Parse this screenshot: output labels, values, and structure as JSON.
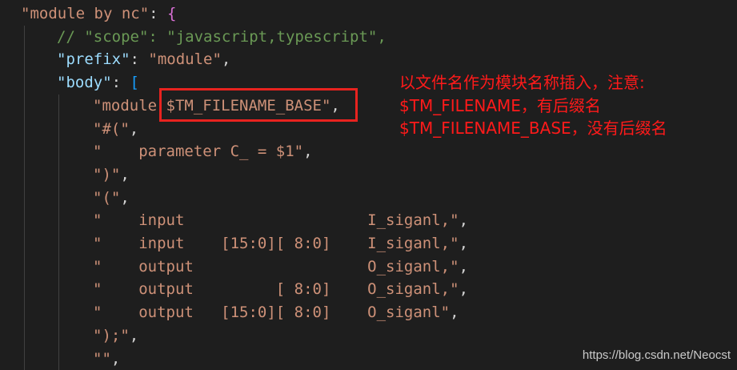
{
  "code_lines": [
    {
      "indent": 0,
      "tokens": [
        {
          "t": "\"module by nc\"",
          "c": "str"
        },
        {
          "t": ": ",
          "c": "punc"
        },
        {
          "t": "{",
          "c": "brace"
        }
      ]
    },
    {
      "indent": 1,
      "tokens": [
        {
          "t": "// \"scope\": \"javascript,typescript\",",
          "c": "comment"
        }
      ]
    },
    {
      "indent": 1,
      "tokens": [
        {
          "t": "\"prefix\"",
          "c": "key"
        },
        {
          "t": ": ",
          "c": "punc"
        },
        {
          "t": "\"module\"",
          "c": "str"
        },
        {
          "t": ",",
          "c": "punc"
        }
      ]
    },
    {
      "indent": 1,
      "tokens": [
        {
          "t": "\"body\"",
          "c": "key"
        },
        {
          "t": ": ",
          "c": "punc"
        },
        {
          "t": "[",
          "c": "bracket"
        }
      ]
    },
    {
      "indent": 2,
      "tokens": [
        {
          "t": "\"module $TM_FILENAME_BASE\"",
          "c": "str"
        },
        {
          "t": ",",
          "c": "punc"
        }
      ]
    },
    {
      "indent": 2,
      "tokens": [
        {
          "t": "\"#(\"",
          "c": "str"
        },
        {
          "t": ",",
          "c": "punc"
        }
      ]
    },
    {
      "indent": 2,
      "tokens": [
        {
          "t": "\"    parameter C_ = $1\"",
          "c": "str"
        },
        {
          "t": ",",
          "c": "punc"
        }
      ]
    },
    {
      "indent": 2,
      "tokens": [
        {
          "t": "\")\"",
          "c": "str"
        },
        {
          "t": ",",
          "c": "punc"
        }
      ]
    },
    {
      "indent": 2,
      "tokens": [
        {
          "t": "\"(\"",
          "c": "str"
        },
        {
          "t": ",",
          "c": "punc"
        }
      ]
    },
    {
      "indent": 2,
      "tokens": [
        {
          "t": "\"    input                    I_siganl,\"",
          "c": "str"
        },
        {
          "t": ",",
          "c": "punc"
        }
      ]
    },
    {
      "indent": 2,
      "tokens": [
        {
          "t": "\"    input    [15:0][ 8:0]    I_siganl,\"",
          "c": "str"
        },
        {
          "t": ",",
          "c": "punc"
        }
      ]
    },
    {
      "indent": 2,
      "tokens": [
        {
          "t": "\"    output                   O_siganl,\"",
          "c": "str"
        },
        {
          "t": ",",
          "c": "punc"
        }
      ]
    },
    {
      "indent": 2,
      "tokens": [
        {
          "t": "\"    output         [ 8:0]    O_siganl,\"",
          "c": "str"
        },
        {
          "t": ",",
          "c": "punc"
        }
      ]
    },
    {
      "indent": 2,
      "tokens": [
        {
          "t": "\"    output   [15:0][ 8:0]    O_siganl\"",
          "c": "str"
        },
        {
          "t": ",",
          "c": "punc"
        }
      ]
    },
    {
      "indent": 2,
      "tokens": [
        {
          "t": "\");\"",
          "c": "str"
        },
        {
          "t": ",",
          "c": "punc"
        }
      ]
    },
    {
      "indent": 2,
      "tokens": [
        {
          "t": "\"\"",
          "c": "str"
        },
        {
          "t": ",",
          "c": "punc"
        }
      ]
    }
  ],
  "annotation": {
    "lines": [
      "以文件名作为模块名称插入，注意:",
      "$TM_FILENAME，有后缀名",
      "$TM_FILENAME_BASE，没有后缀名"
    ]
  },
  "watermark": "https://blog.csdn.net/Neocst",
  "colors": {
    "background": "#1e1e1e",
    "string": "#ce9178",
    "key": "#9cdcfe",
    "comment": "#6a9955",
    "brace": "#da70d6",
    "bracket": "#179fff",
    "annotation": "#ff1a1a",
    "highlight_box": "#e8231f"
  }
}
